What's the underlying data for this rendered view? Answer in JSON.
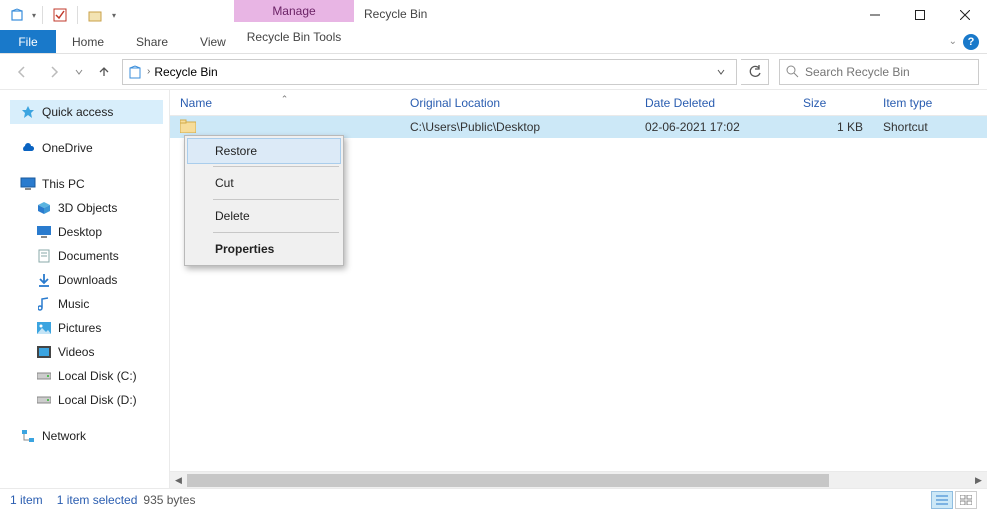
{
  "window": {
    "title": "Recycle Bin",
    "context_tab": "Manage",
    "tool_tab": "Recycle Bin Tools"
  },
  "ribbon": {
    "file": "File",
    "home": "Home",
    "share": "Share",
    "view": "View"
  },
  "address": {
    "location": "Recycle Bin"
  },
  "search": {
    "placeholder": "Search Recycle Bin"
  },
  "sidebar": {
    "quick": "Quick access",
    "onedrive": "OneDrive",
    "thispc": "This PC",
    "children": [
      {
        "label": "3D Objects"
      },
      {
        "label": "Desktop"
      },
      {
        "label": "Documents"
      },
      {
        "label": "Downloads"
      },
      {
        "label": "Music"
      },
      {
        "label": "Pictures"
      },
      {
        "label": "Videos"
      },
      {
        "label": "Local Disk (C:)"
      },
      {
        "label": "Local Disk (D:)"
      }
    ],
    "network": "Network"
  },
  "columns": {
    "name": "Name",
    "loc": "Original Location",
    "date": "Date Deleted",
    "size": "Size",
    "type": "Item type"
  },
  "row": {
    "name": "",
    "loc": "C:\\Users\\Public\\Desktop",
    "date": "02-06-2021 17:02",
    "size": "1 KB",
    "type": "Shortcut"
  },
  "context_menu": {
    "restore": "Restore",
    "cut": "Cut",
    "delete": "Delete",
    "properties": "Properties"
  },
  "status": {
    "count": "1 item",
    "selected": "1 item selected",
    "bytes": "935 bytes"
  }
}
